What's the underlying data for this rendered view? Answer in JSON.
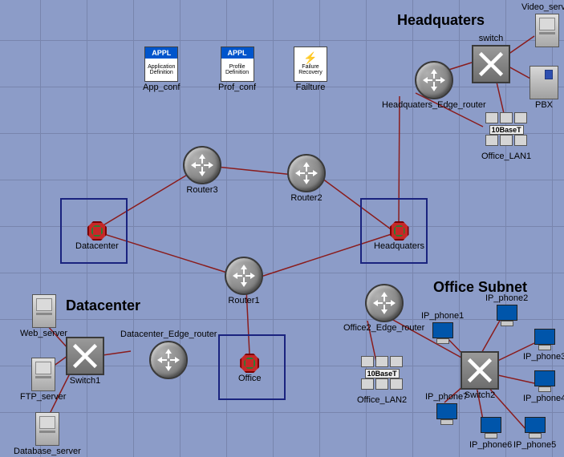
{
  "titles": {
    "hq": "Headquaters",
    "dc": "Datacenter",
    "os": "Office Subnet"
  },
  "palette": {
    "app_head": "APPL",
    "app_body1": "Application",
    "app_body2": "Definition",
    "app_label": "App_conf",
    "prof_body1": "Profile",
    "prof_body2": "Definition",
    "prof_label": "Prof_conf",
    "fail_body1": "Failure",
    "fail_body2": "Recovery",
    "fail_label": "Failture"
  },
  "backbone": {
    "r1": "Router1",
    "r2": "Router2",
    "r3": "Router3",
    "dc_sub": "Datacenter",
    "hq_sub": "Headquaters",
    "of_sub": "Office"
  },
  "hq": {
    "edge": "Headquaters_Edge_router",
    "switch": "switch",
    "video": "Video_server",
    "pbx": "PBX",
    "lan_tag": "10BaseT",
    "lan": "Office_LAN1"
  },
  "dc": {
    "edge": "Datacenter_Edge_router",
    "sw": "Switch1",
    "web": "Web_server",
    "ftp": "FTP_server",
    "db": "Database_server"
  },
  "os": {
    "edge": "Office2_Edge_router",
    "sw": "Switch2",
    "lan_tag": "10BaseT",
    "lan": "Office_LAN2",
    "p1": "IP_phone1",
    "p2": "IP_phone2",
    "p3": "IP_phone3",
    "p4": "IP_phone4",
    "p5": "IP_phone5",
    "p6": "IP_phone6",
    "p7": "IP_phone7"
  }
}
